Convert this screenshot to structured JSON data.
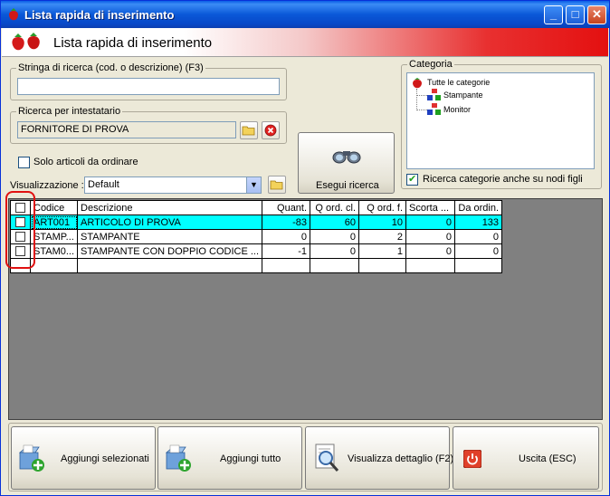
{
  "window": {
    "title": "Lista rapida di inserimento"
  },
  "banner": {
    "title": "Lista rapida di inserimento"
  },
  "search": {
    "legend": "Stringa di ricerca (cod. o descrizione) (F3)",
    "value": ""
  },
  "holder": {
    "legend": "Ricerca per intestatario",
    "value": "FORNITORE DI PROVA"
  },
  "only_to_order": {
    "label": "Solo articoli da ordinare",
    "checked": false
  },
  "view": {
    "label": "Visualizzazione :",
    "value": "Default"
  },
  "search_button": {
    "label": "Esegui ricerca"
  },
  "category": {
    "legend": "Categoria",
    "root": "Tutte le categorie",
    "children": [
      "Stampante",
      "Monitor"
    ],
    "subnodes_label": "Ricerca categorie anche su nodi figli",
    "subnodes_checked": true
  },
  "grid": {
    "columns": [
      "Codice",
      "Descrizione",
      "Quant.",
      "Q ord. cl.",
      "Q ord. f.",
      "Scorta ...",
      "Da ordin."
    ],
    "rows": [
      [
        "ART001",
        "ARTICOLO DI PROVA",
        "-83",
        "60",
        "10",
        "0",
        "133"
      ],
      [
        "STAMP...",
        "STAMPANTE",
        "0",
        "0",
        "2",
        "0",
        "0"
      ],
      [
        "STAM0...",
        "STAMPANTE CON DOPPIO CODICE ...",
        "-1",
        "0",
        "1",
        "0",
        "0"
      ]
    ],
    "selected_row": 0
  },
  "buttons": {
    "add_selected": "Aggiungi selezionati",
    "add_all": "Aggiungi tutto",
    "show_detail": "Visualizza dettaglio (F2)",
    "exit": "Uscita (ESC)"
  }
}
